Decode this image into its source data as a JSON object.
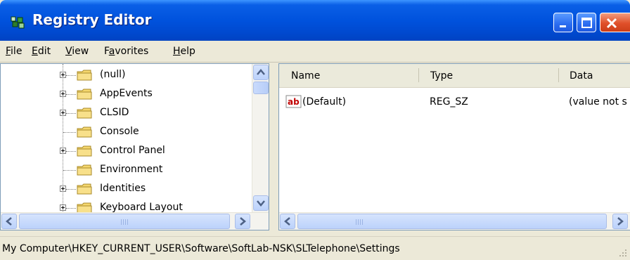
{
  "window": {
    "title": "Registry Editor",
    "controls": [
      "minimize",
      "maximize",
      "close"
    ]
  },
  "menu": [
    {
      "label": "File",
      "accel": "F"
    },
    {
      "label": "Edit",
      "accel": "E"
    },
    {
      "label": "View",
      "accel": "V"
    },
    {
      "label": "Favorites",
      "accel": "a"
    },
    {
      "label": "Help",
      "accel": "H"
    }
  ],
  "tree": {
    "items": [
      {
        "label": "(null)",
        "expandable": true
      },
      {
        "label": "AppEvents",
        "expandable": true
      },
      {
        "label": "CLSID",
        "expandable": true
      },
      {
        "label": "Console",
        "expandable": false
      },
      {
        "label": "Control Panel",
        "expandable": true
      },
      {
        "label": "Environment",
        "expandable": false
      },
      {
        "label": "Identities",
        "expandable": true
      },
      {
        "label": "Keyboard Layout",
        "expandable": true
      }
    ]
  },
  "list": {
    "columns": [
      "Name",
      "Type",
      "Data"
    ],
    "rows": [
      {
        "name": "(Default)",
        "type": "REG_SZ",
        "data": "(value not s",
        "icon": "string-value-icon"
      }
    ]
  },
  "status": {
    "path": "My Computer\\HKEY_CURRENT_USER\\Software\\SoftLab-NSK\\SLTelephone\\Settings"
  },
  "icons": {
    "app": "registry-editor-icon",
    "folder": "folder-icon",
    "expand": "plus-box-icon",
    "scroll_up": "arrow-up-icon",
    "scroll_down": "arrow-down-icon",
    "scroll_left": "arrow-left-icon",
    "scroll_right": "arrow-right-icon"
  },
  "colors": {
    "titlebar": "#0052dd",
    "close": "#e0502a",
    "folder": "#f5d76e",
    "window_bg": "#ece9d8"
  }
}
